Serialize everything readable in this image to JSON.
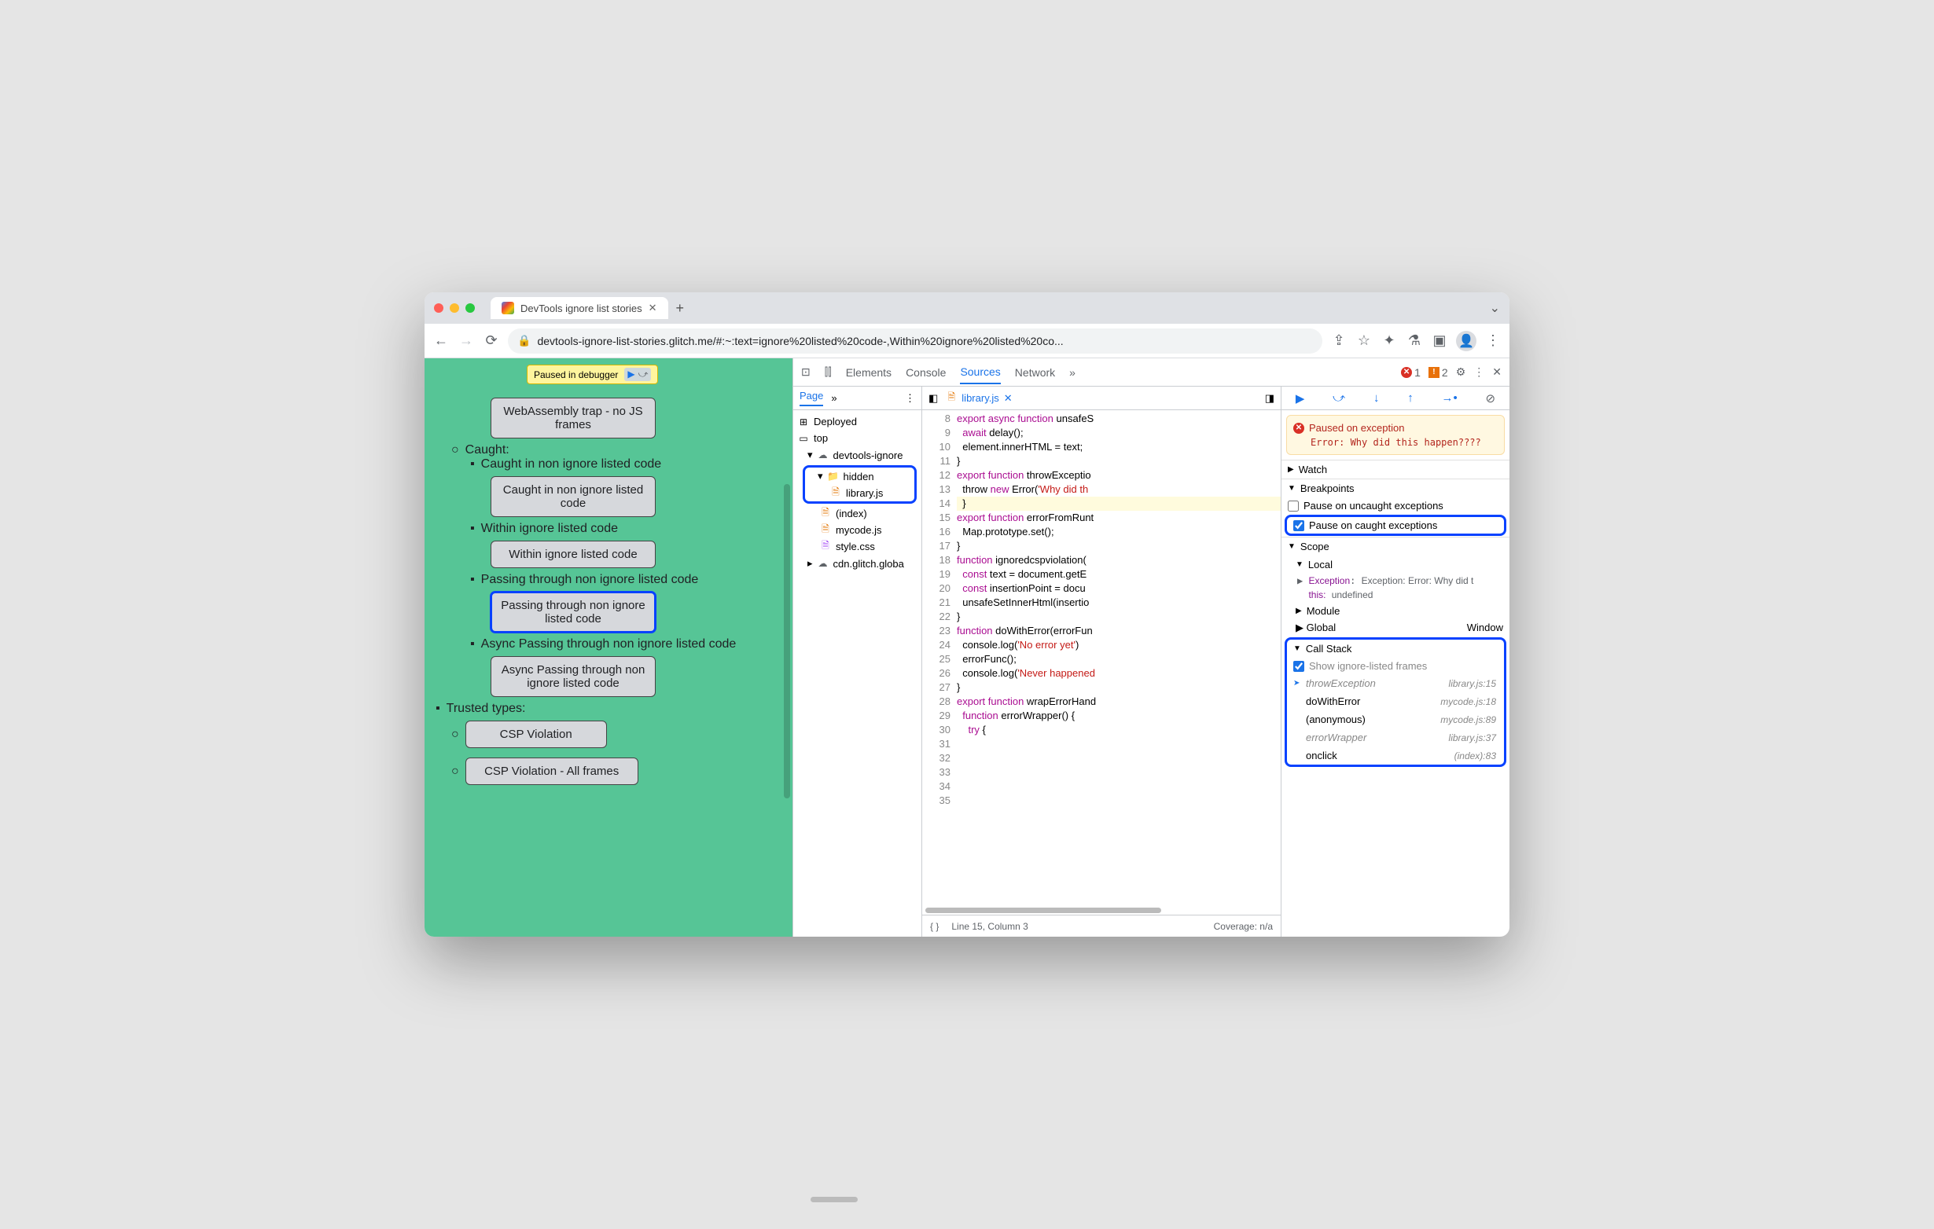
{
  "browser": {
    "tab_title": "DevTools ignore list stories",
    "url": "devtools-ignore-list-stories.glitch.me/#:~:text=ignore%20listed%20code-,Within%20ignore%20listed%20co..."
  },
  "paused_chip": "Paused in debugger",
  "page": {
    "btn_webassembly": "WebAssembly trap - no JS frames",
    "caught_header": "Caught:",
    "item_caught_non_ignore": "Caught in non ignore listed code",
    "btn_caught_non_ignore": "Caught in non ignore listed code",
    "item_within": "Within ignore listed code",
    "btn_within": "Within ignore listed code",
    "item_passing": "Passing through non ignore listed code",
    "btn_passing": "Passing through non ignore listed code",
    "item_async": "Async Passing through non ignore listed code",
    "btn_async": "Async Passing through non ignore listed code",
    "trusted_header": "Trusted types:",
    "btn_csp": "CSP Violation",
    "btn_csp_all": "CSP Violation - All frames"
  },
  "devtools": {
    "tabs": {
      "elements": "Elements",
      "console": "Console",
      "sources": "Sources",
      "network": "Network"
    },
    "errors": "1",
    "warnings": "2",
    "page_tab": "Page",
    "file_tab": "library.js",
    "tree": {
      "deployed": "Deployed",
      "top": "top",
      "origin": "devtools-ignore",
      "hidden": "hidden",
      "library": "library.js",
      "index": "(index)",
      "mycode": "mycode.js",
      "style": "style.css",
      "cdn": "cdn.glitch.globa"
    },
    "code_lines": [
      "export async function unsafeS",
      "  await delay();",
      "  element.innerHTML = text;",
      "}",
      "",
      "export function throwExceptio",
      "  throw new Error('Why did th",
      "}",
      "",
      "export function errorFromRunt",
      "  Map.prototype.set();",
      "}",
      "",
      "function ignoredcspviolation(",
      "  const text = document.getE",
      "  const insertionPoint = docu",
      "  unsafeSetInnerHtml(insertio",
      "}",
      "",
      "function doWithError(errorFun",
      "  console.log('No error yet')",
      "  errorFunc();",
      "  console.log('Never happened",
      "}",
      "",
      "export function wrapErrorHand",
      "  function errorWrapper() {",
      "    try {"
    ],
    "line_start": 8,
    "status": {
      "pos": "Line 15, Column 3",
      "coverage": "Coverage: n/a"
    },
    "pause": {
      "title": "Paused on exception",
      "msg": "Error: Why did this happen????"
    },
    "panels": {
      "watch": "Watch",
      "breakpoints": "Breakpoints",
      "bp_uncaught": "Pause on uncaught exceptions",
      "bp_caught": "Pause on caught exceptions",
      "scope": "Scope",
      "local": "Local",
      "exception": "Exception: Error: Why did t",
      "this_label": "this:",
      "this_val": "undefined",
      "module": "Module",
      "global": "Global",
      "window": "Window",
      "callstack": "Call Stack",
      "show_ignored": "Show ignore-listed frames"
    },
    "stack": [
      {
        "fn": "throwException",
        "loc": "library.js:15",
        "ignored": true,
        "active": true
      },
      {
        "fn": "doWithError",
        "loc": "mycode.js:18"
      },
      {
        "fn": "(anonymous)",
        "loc": "mycode.js:89"
      },
      {
        "fn": "errorWrapper",
        "loc": "library.js:37",
        "ignored": true
      },
      {
        "fn": "onclick",
        "loc": "(index):83"
      }
    ]
  }
}
